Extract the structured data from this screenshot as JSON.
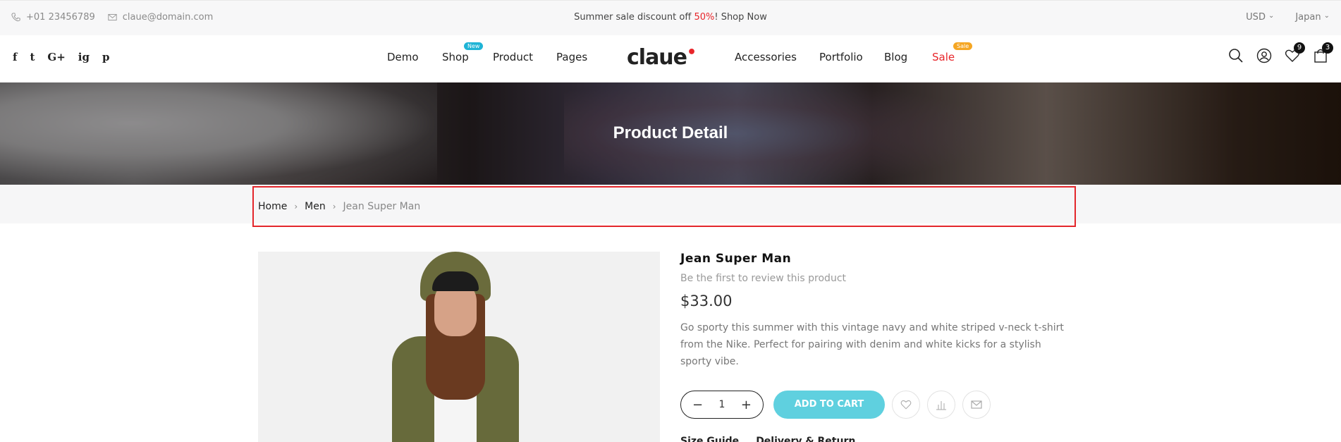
{
  "topbar": {
    "phone": "+01 23456789",
    "email": "claue@domain.com",
    "promo_before": "Summer sale discount off ",
    "promo_pct": "50%",
    "promo_after": "! Shop Now",
    "currency": "USD",
    "language": "Japan"
  },
  "header": {
    "social": [
      "f",
      "t",
      "G+",
      "ig",
      "p"
    ],
    "nav": {
      "demo": "Demo",
      "shop": "Shop",
      "shop_badge": "New",
      "product": "Product",
      "pages": "Pages",
      "accessories": "Accessories",
      "portfolio": "Portfolio",
      "blog": "Blog",
      "sale": "Sale",
      "sale_badge": "Sale"
    },
    "logo": "claue",
    "wishlist_count": "9",
    "cart_count": "3"
  },
  "banner": {
    "title": "Product Detail"
  },
  "breadcrumb": {
    "home": "Home",
    "category": "Men",
    "current": "Jean Super Man"
  },
  "product": {
    "name": "Jean Super Man",
    "review": "Be the first to review this product",
    "price": "$33.00",
    "description": "Go sporty this summer with this vintage navy and white striped v-neck t-shirt from the Nike. Perfect for pairing with denim and white kicks for a stylish sporty vibe.",
    "quantity": "1",
    "add_to_cart": "ADD TO CART",
    "size_guide": "Size Guide",
    "delivery": "Delivery & Return"
  },
  "colors": {
    "accent": "#5fd0df",
    "sale": "#e8252a",
    "new_badge": "#1fb4d6",
    "sale_badge": "#f5a623"
  }
}
